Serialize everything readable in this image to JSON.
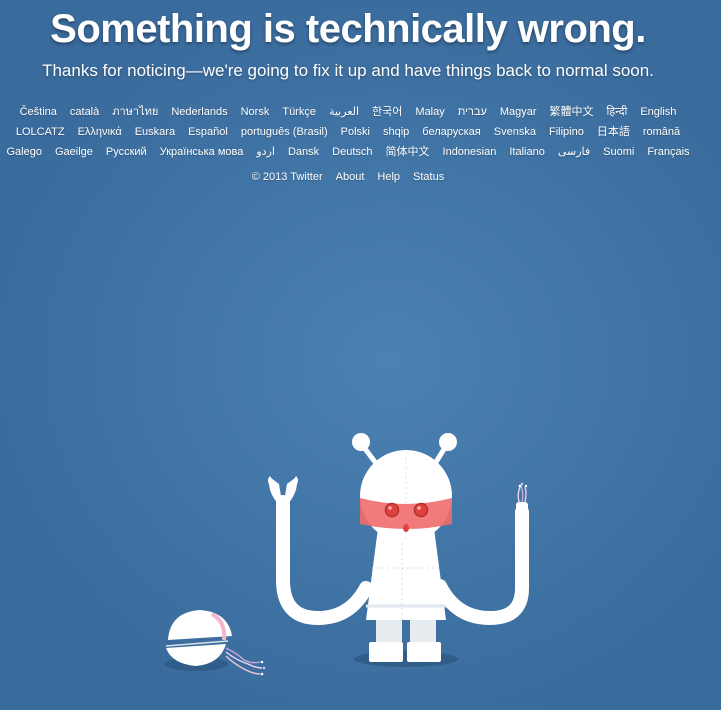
{
  "error": {
    "headline": "Something is technically wrong.",
    "message": "Thanks for noticing—we're going to fix it up and have things back to normal soon."
  },
  "languages": {
    "row1": [
      "Čeština",
      "català",
      "ภาษาไทย",
      "Nederlands",
      "Norsk",
      "Türkçe",
      "العربية",
      "한국어",
      "Malay",
      "עברית",
      "Magyar",
      "繁體中文",
      "हिन्दी",
      "English"
    ],
    "row2": [
      "LOLCATZ",
      "Ελληνικά",
      "Euskara",
      "Español",
      "português (Brasil)",
      "Polski",
      "shqip",
      "беларуская",
      "Svenska",
      "Filipino",
      "日本語",
      "română"
    ],
    "row3": [
      "Galego",
      "Gaeilge",
      "Русский",
      "Українська мова",
      "اردو",
      "Dansk",
      "Deutsch",
      "简体中文",
      "Indonesian",
      "Italiano",
      "فارسی",
      "Suomi",
      "Français"
    ]
  },
  "footer": {
    "copyright": "© 2013 Twitter",
    "about": "About",
    "help": "Help",
    "status": "Status"
  },
  "colors": {
    "background": "#4277a8",
    "robot_body": "#ffffff",
    "robot_eye": "#e0433f",
    "visor": "#f06b6b",
    "shadow": "#2f5a85"
  }
}
